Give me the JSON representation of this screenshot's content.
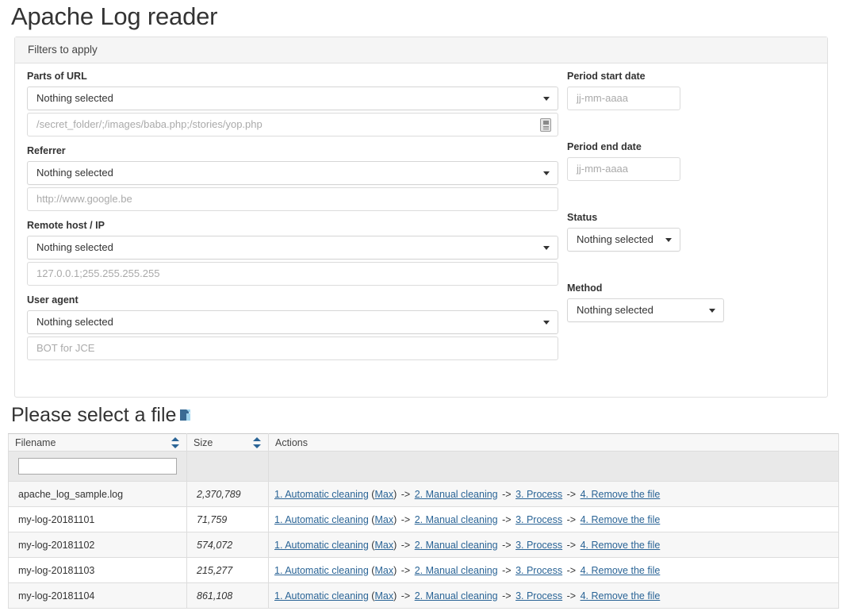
{
  "page": {
    "title": "Apache Log reader"
  },
  "filters_panel": {
    "heading": "Filters to apply",
    "left_fields": [
      {
        "label": "Parts of URL",
        "select_value": "Nothing selected",
        "input_placeholder": "/secret_folder/;/images/baba.php;/stories/yop.php",
        "has_autofill_icon": true
      },
      {
        "label": "Referrer",
        "select_value": "Nothing selected",
        "input_placeholder": "http://www.google.be",
        "has_autofill_icon": false
      },
      {
        "label": "Remote host / IP",
        "select_value": "Nothing selected",
        "input_placeholder": "127.0.0.1;255.255.255.255",
        "has_autofill_icon": false
      },
      {
        "label": "User agent",
        "select_value": "Nothing selected",
        "input_placeholder": "BOT for JCE",
        "has_autofill_icon": false
      }
    ],
    "right_fields": [
      {
        "label": "Period start date",
        "kind": "date",
        "input_placeholder": "jj-mm-aaaa"
      },
      {
        "label": "Period end date",
        "kind": "date",
        "input_placeholder": "jj-mm-aaaa"
      },
      {
        "label": "Status",
        "kind": "select",
        "select_value": "Nothing selected"
      },
      {
        "label": "Method",
        "kind": "select",
        "select_value": "Nothing selected"
      }
    ]
  },
  "file_section": {
    "title": "Please select a file",
    "icon": "file-icon",
    "table": {
      "columns": [
        "Filename",
        "Size",
        "Actions"
      ],
      "filter_input_value": "",
      "rows": [
        {
          "filename": "apache_log_sample.log",
          "size": "2,370,789",
          "actions": {
            "automatic_cleaning": "1. Automatic cleaning",
            "max": "Max",
            "manual_cleaning": "2. Manual cleaning",
            "process": "3. Process",
            "remove": "4. Remove the file",
            "separator": "->"
          }
        },
        {
          "filename": "my-log-20181101",
          "size": "71,759",
          "actions": {
            "automatic_cleaning": "1. Automatic cleaning",
            "max": "Max",
            "manual_cleaning": "2. Manual cleaning",
            "process": "3. Process",
            "remove": "4. Remove the file",
            "separator": "->"
          }
        },
        {
          "filename": "my-log-20181102",
          "size": "574,072",
          "actions": {
            "automatic_cleaning": "1. Automatic cleaning",
            "max": "Max",
            "manual_cleaning": "2. Manual cleaning",
            "process": "3. Process",
            "remove": "4. Remove the file",
            "separator": "->"
          }
        },
        {
          "filename": "my-log-20181103",
          "size": "215,277",
          "actions": {
            "automatic_cleaning": "1. Automatic cleaning",
            "max": "Max",
            "manual_cleaning": "2. Manual cleaning",
            "process": "3. Process",
            "remove": "4. Remove the file",
            "separator": "->"
          }
        },
        {
          "filename": "my-log-20181104",
          "size": "861,108",
          "actions": {
            "automatic_cleaning": "1. Automatic cleaning",
            "max": "Max",
            "manual_cleaning": "2. Manual cleaning",
            "process": "3. Process",
            "remove": "4. Remove the file",
            "separator": "->"
          }
        }
      ]
    }
  },
  "colors": {
    "link": "#2a6496",
    "panel_header_bg": "#f5f5f5",
    "table_header_bg": "#f7f7f7",
    "filter_row_bg": "#e9e9e9",
    "sort_icon": "#2a6496",
    "text": "#333333",
    "placeholder": "#aaaaaa"
  }
}
